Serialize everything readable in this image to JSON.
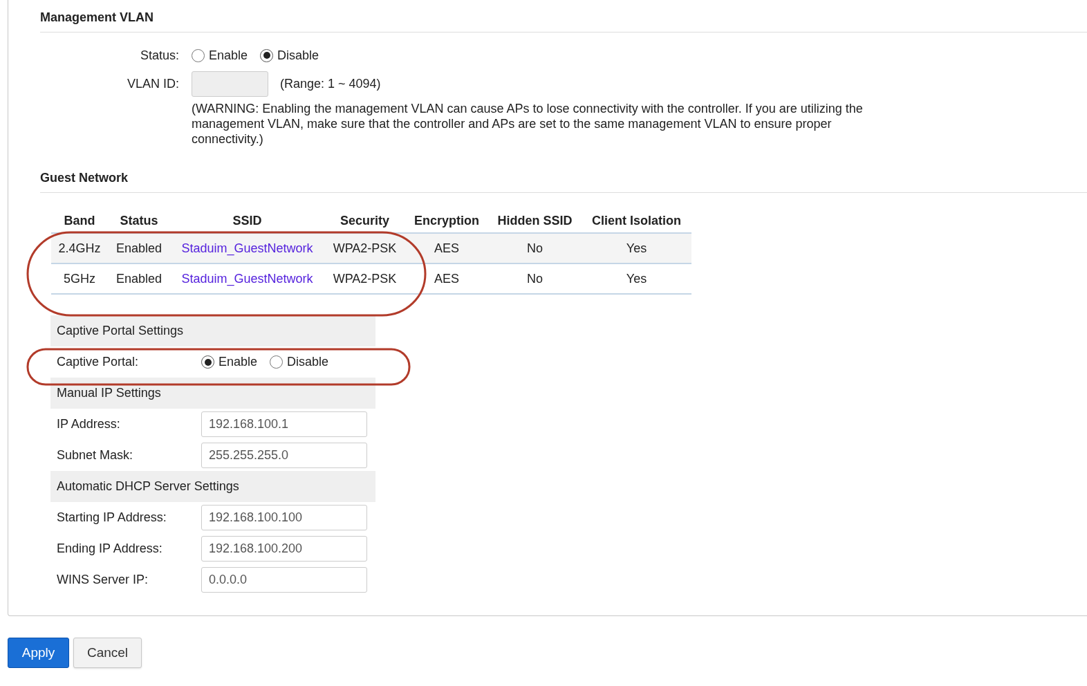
{
  "management_vlan": {
    "heading": "Management VLAN",
    "status_label": "Status:",
    "status_options": [
      {
        "label": "Enable",
        "selected": false
      },
      {
        "label": "Disable",
        "selected": true
      }
    ],
    "vlan_id_label": "VLAN ID:",
    "range": "(Range: 1 ~ 4094)",
    "warning": "(WARNING: Enabling the management VLAN can cause APs to lose connectivity with the controller. If you are utilizing the management VLAN, make sure that the controller and APs are set to the same management VLAN to ensure proper connectivity.)"
  },
  "guest_network": {
    "heading": "Guest Network",
    "table": {
      "columns": [
        "Band",
        "Status",
        "SSID",
        "Security",
        "Encryption",
        "Hidden SSID",
        "Client Isolation"
      ],
      "rows": [
        {
          "band": "2.4GHz",
          "status": "Enabled",
          "ssid": "Staduim_GuestNetwork",
          "security": "WPA2-PSK",
          "encryption": "AES",
          "hidden_ssid": "No",
          "client_isolation": "Yes"
        },
        {
          "band": "5GHz",
          "status": "Enabled",
          "ssid": "Staduim_GuestNetwork",
          "security": "WPA2-PSK",
          "encryption": "AES",
          "hidden_ssid": "No",
          "client_isolation": "Yes"
        }
      ]
    }
  },
  "captive_portal": {
    "sections": [
      {
        "heading": "Captive Portal Settings",
        "rows": [
          {
            "kind": "radio",
            "label": "Captive Portal:",
            "options": [
              {
                "label": "Enable",
                "selected": true
              },
              {
                "label": "Disable",
                "selected": false
              }
            ]
          }
        ]
      },
      {
        "heading": "Manual IP Settings",
        "rows": [
          {
            "kind": "input",
            "label": "IP Address:",
            "value": "192.168.100.1"
          },
          {
            "kind": "input",
            "label": "Subnet Mask:",
            "value": "255.255.255.0"
          }
        ]
      },
      {
        "heading": "Automatic DHCP Server Settings",
        "rows": [
          {
            "kind": "input",
            "label": "Starting IP Address:",
            "value": "192.168.100.100"
          },
          {
            "kind": "input",
            "label": "Ending IP Address:",
            "value": "192.168.100.200"
          },
          {
            "kind": "input",
            "label": "WINS Server IP:",
            "value": "0.0.0.0"
          }
        ]
      }
    ]
  },
  "buttons": [
    {
      "label": "Apply",
      "kind": "primary"
    },
    {
      "label": "Cancel",
      "kind": "secondary"
    }
  ]
}
